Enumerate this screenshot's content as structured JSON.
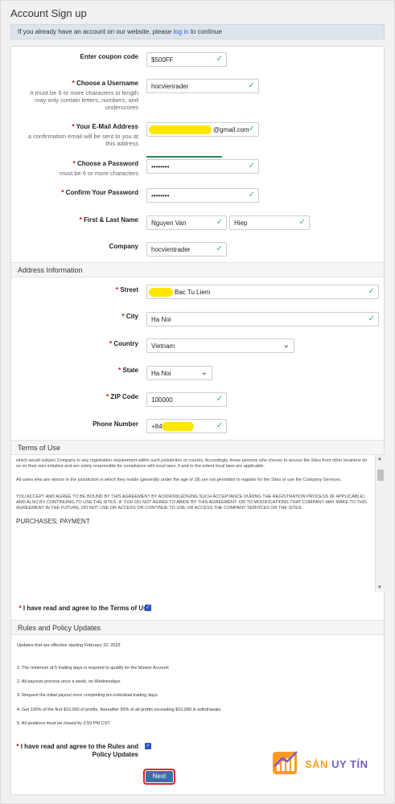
{
  "page": {
    "title": "Account Sign up"
  },
  "info": {
    "prefix": "If you already have an account on our website, please ",
    "link": "log in",
    "suffix": " to continue"
  },
  "form": {
    "coupon": {
      "label": "Enter coupon code",
      "value": "$500FF"
    },
    "username": {
      "label": "Choose a Username",
      "hint": "It must be 6 or more characters in length may only contain letters, numbers, and underscores",
      "value": "hocvienrader"
    },
    "email": {
      "label": "Your E-Mail Address",
      "hint": "a confirmation email will be sent to you at this address",
      "value": "@gmail.com"
    },
    "password": {
      "label": "Choose a Password",
      "hint": "must be 6 or more characters",
      "value": "••••••••"
    },
    "confirm_password": {
      "label": "Confirm Your Password",
      "value": "••••••••"
    },
    "name": {
      "label": "First & Last Name",
      "first": "Nguyen Van",
      "last": "Hiep"
    },
    "company": {
      "label": "Company",
      "value": "hocvientrader"
    }
  },
  "address": {
    "section_title": "Address Information",
    "street": {
      "label": "Street",
      "value": "Bac Tu Liem"
    },
    "city": {
      "label": "City",
      "value": "Ha Noi"
    },
    "country": {
      "label": "Country",
      "value": "Vietnam"
    },
    "state": {
      "label": "State",
      "value": "Ha Noi"
    },
    "zip": {
      "label": "ZIP Code",
      "value": "100000"
    },
    "phone": {
      "label": "Phone Number",
      "value": "+84"
    }
  },
  "terms": {
    "section_title": "Terms of Use",
    "p1": "which would subject Company to any registration requirement within such jurisdiction or country. Accordingly, those persons who choose to access the Sites from other locations do so on their own initiative and are solely responsible for compliance with local laws, if and to the extent local laws are applicable.",
    "p2": "All users who are minors in the jurisdiction in which they reside (generally under the age of 18) are not permitted to register for the Sites or use the Company Services.",
    "p3": "YOU ACCEPT AND AGREE TO BE BOUND BY THIS AGREEMENT BY ACKNOWLEDGING SUCH ACCEPTANCE DURING THE REGISTRATION PROCESS (IF APPLICABLE) AND ALSO BY CONTINUING TO USE THE SITES. IF YOU DO NOT AGREE TO ABIDE BY THIS AGREEMENT, OR TO MODIFICATIONS THAT COMPANY MAY MAKE TO THIS AGREEMENT IN THE FUTURE, DO NOT USE OR ACCESS OR CONTINUE TO USE OR ACCESS THE COMPANY SERVICES OR THE SITES.",
    "heading": "PURCHASES; PAYMENT",
    "agree_label": "I have read and agree to the Terms of Use"
  },
  "rules": {
    "section_title": "Rules and Policy Updates",
    "intro": "Updates that are effective starting February 22, 2023",
    "items": [
      "1.   The minimum of 5 trading days is required to qualify for the Master Account",
      "2.   All payouts process once a week, on Wednesdays.",
      "3.   Request the initial payout once completing ten individual trading days.",
      "4.   Get 100% of the first $10,000 of profits, thereafter 90% of all profits exceeding $10,000 in withdrawals.",
      "5.   All positions must be closed by 3:59 PM CST."
    ],
    "agree_label_1": "I have read and agree to the Rules and",
    "agree_label_2": "Policy Updates"
  },
  "actions": {
    "next": "Next"
  },
  "watermark": {
    "brand_a": "SÀN",
    "brand_b": "UY TÍN"
  },
  "colors": {
    "accent": "#3c6ea8",
    "valid": "#3bb273",
    "required": "#cc0000",
    "highlight": "#ffe600"
  }
}
